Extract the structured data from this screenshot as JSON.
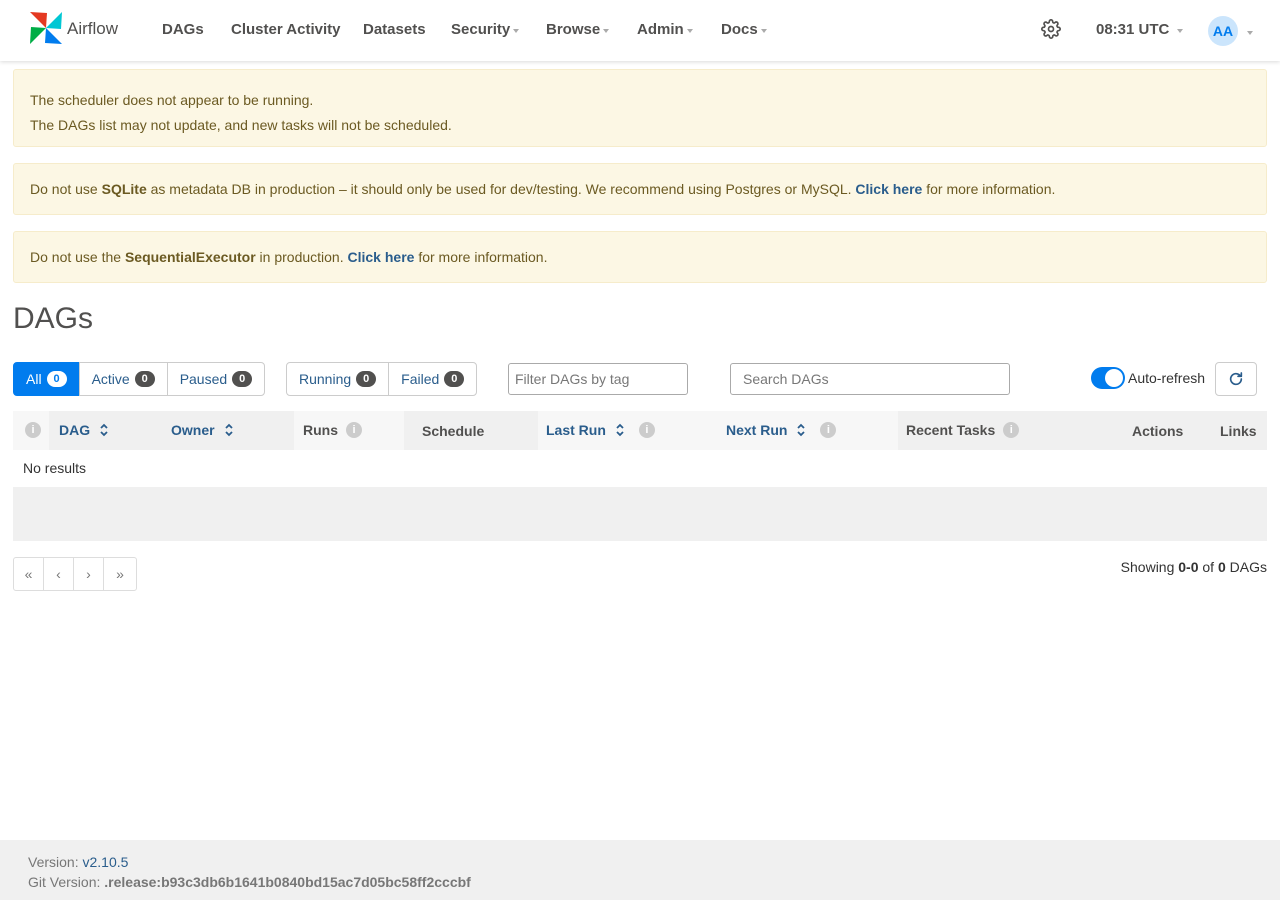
{
  "app": {
    "brand": "Airflow"
  },
  "nav": {
    "items": [
      {
        "label": "DAGs"
      },
      {
        "label": "Cluster Activity"
      },
      {
        "label": "Datasets"
      },
      {
        "label": "Security"
      },
      {
        "label": "Browse"
      },
      {
        "label": "Admin"
      },
      {
        "label": "Docs"
      }
    ],
    "time": "08:31 UTC",
    "avatar": "AA"
  },
  "alerts": {
    "scheduler_line1": "The scheduler does not appear to be running.",
    "scheduler_line2": "The DAGs list may not update, and new tasks will not be scheduled.",
    "sqlite_pre": "Do not use ",
    "sqlite_bold": "SQLite",
    "sqlite_mid": " as metadata DB in production – it should only be used for dev/testing. We recommend using Postgres or MySQL. ",
    "sqlite_link": "Click here",
    "sqlite_post": " for more information.",
    "executor_pre": "Do not use the ",
    "executor_bold": "SequentialExecutor",
    "executor_mid": " in production. ",
    "executor_link": "Click here",
    "executor_post": " for more information."
  },
  "page": {
    "title": "DAGs"
  },
  "filters": {
    "all": {
      "label": "All",
      "count": "0"
    },
    "active": {
      "label": "Active",
      "count": "0"
    },
    "paused": {
      "label": "Paused",
      "count": "0"
    },
    "running": {
      "label": "Running",
      "count": "0"
    },
    "failed": {
      "label": "Failed",
      "count": "0"
    },
    "tag_placeholder": "Filter DAGs by tag",
    "search_placeholder": "Search DAGs",
    "auto_refresh": "Auto-refresh"
  },
  "table": {
    "headers": {
      "dag": "DAG",
      "owner": "Owner",
      "runs": "Runs",
      "schedule": "Schedule",
      "last_run": "Last Run",
      "next_run": "Next Run",
      "recent_tasks": "Recent Tasks",
      "actions": "Actions",
      "links": "Links"
    },
    "empty": "No results"
  },
  "pagination": {
    "first": "«",
    "prev": "‹",
    "next": "›",
    "last": "»",
    "showing_pre": "Showing ",
    "range": "0-0",
    "of": " of ",
    "total": "0",
    "suffix": " DAGs"
  },
  "footer": {
    "version_label": "Version: ",
    "version": "v2.10.5",
    "git_label": "Git Version: ",
    "git": ".release:b93c3db6b1641b0840bd15ac7d05bc58ff2cccbf"
  }
}
